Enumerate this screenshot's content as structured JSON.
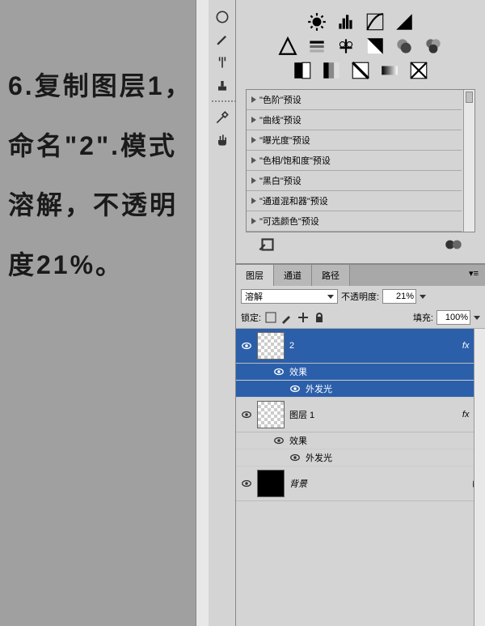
{
  "canvas": {
    "text": "6.复制图层1，命名\"2\".模式溶解，不透明度21%。"
  },
  "presets": {
    "items": [
      "\"色阶\"预设",
      "\"曲线\"预设",
      "\"曝光度\"预设",
      "\"色相/饱和度\"预设",
      "\"黑白\"预设",
      "\"通道混和器\"预设",
      "\"可选颜色\"预设"
    ]
  },
  "layers_panel": {
    "tabs": {
      "layers": "图层",
      "channels": "通道",
      "paths": "路径"
    },
    "blend_mode": "溶解",
    "opacity_label": "不透明度:",
    "opacity_value": "21%",
    "lock_label": "锁定:",
    "fill_label": "填充:",
    "fill_value": "100%",
    "layers": [
      {
        "name": "2",
        "fx": true,
        "selected": true,
        "thumb": "checker"
      },
      {
        "name": "图层 1",
        "fx": true,
        "selected": false,
        "thumb": "checker"
      },
      {
        "name": "背景",
        "fx": false,
        "selected": false,
        "thumb": "black",
        "locked": true
      }
    ],
    "effects_label": "效果",
    "outer_glow_label": "外发光"
  }
}
